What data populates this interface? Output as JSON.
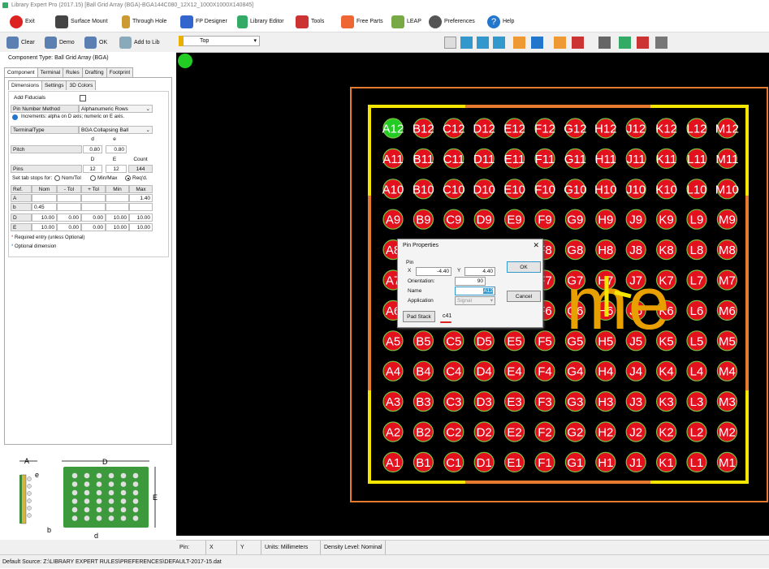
{
  "window_title": "Library Expert Pro (2017.15) [Ball Grid Array (BGA)-BGA144C080_12X12_1000X1000X140845]",
  "menu": [
    "Exit",
    "Surface Mount",
    "Through Hole",
    "FP Designer",
    "Library Editor",
    "Tools",
    "Free Parts",
    "LEAP",
    "Preferences",
    "Help"
  ],
  "left_toolbar": [
    "Clear",
    "Demo",
    "OK",
    "Add to Lib"
  ],
  "component_type": "Component Type: Ball Grid Array (BGA)",
  "tabs": [
    "Component",
    "Terminal",
    "Rules",
    "Drafting",
    "Footprint"
  ],
  "subtabs": [
    "Dimensions",
    "Settings",
    "3D Colors"
  ],
  "form": {
    "add_fiducials": "Add Fiducials",
    "pin_number_method_label": "Pin Number Method",
    "pin_number_method_value": "Alphanumeric Rows",
    "increments_note": "Increments: alpha on D axis; numeric on E axis.",
    "terminal_type_label": "TerminalType",
    "terminal_type_value": "BGA Collapsing Ball",
    "col_d": "d",
    "col_e": "e",
    "pitch_label": "Pitch",
    "pitch_d": "0.80",
    "pitch_e": "0.80",
    "col_D": "D",
    "col_E": "E",
    "col_count": "Count",
    "pins_label": "Pins",
    "pins_D": "12",
    "pins_E": "12",
    "pins_count": "144",
    "tab_stops_label": "Set tab stops for:",
    "radio1": "Nom/Tol",
    "radio2": "Min/Max",
    "radio3": "Req'd.",
    "table_headers": [
      "Ref.",
      "Nom",
      "- Tol",
      "+ Tol",
      "Min",
      "Max"
    ],
    "rows": [
      {
        "ref": "A",
        "nom": "",
        "mtol": "",
        "ptol": "",
        "min": "",
        "max": "1.40"
      },
      {
        "ref": "b",
        "nom": "0.45",
        "mtol": "",
        "ptol": "",
        "min": "",
        "max": ""
      },
      {
        "ref": "D",
        "nom": "10.00",
        "mtol": "0.00",
        "ptol": "0.00",
        "min": "10.00",
        "max": "10.00"
      },
      {
        "ref": "E",
        "nom": "10.00",
        "mtol": "0.00",
        "ptol": "0.00",
        "min": "10.00",
        "max": "10.00"
      }
    ],
    "required_note": "Required entry (unless Optional)",
    "optional_note": "Optional dimension"
  },
  "view": {
    "layer": "Top"
  },
  "pads": {
    "cols": [
      "A",
      "B",
      "C",
      "D",
      "E",
      "F",
      "G",
      "H",
      "J",
      "K",
      "L",
      "M"
    ],
    "rows": 12
  },
  "silk_text": "me",
  "dialog": {
    "title": "Pin Properties",
    "pin_label": "Pin",
    "x_label": "X",
    "x_value": "-4.40",
    "y_label": "Y",
    "y_value": "4.40",
    "orientation_label": "Orientation:",
    "orientation_value": "90",
    "name_label": "Name",
    "name_value": "A12",
    "application_label": "Application",
    "application_value": "Signal",
    "ok": "OK",
    "cancel": "Cancel",
    "padstack_button": "Pad Stack",
    "padstack_value": "c41"
  },
  "diagram_labels": {
    "A": "A",
    "D": "D",
    "E": "E",
    "e": "e",
    "b": "b",
    "d": "d"
  },
  "status": {
    "pin": "Pin:",
    "x": "X",
    "y": "Y",
    "units": "Units: Millimeters",
    "density": "Density Level: Nominal"
  },
  "bottom": "Default Source:  Z:\\LIBRARY EXPERT RULES\\PREFERENCES\\DEFAULT-2017-15.dat"
}
